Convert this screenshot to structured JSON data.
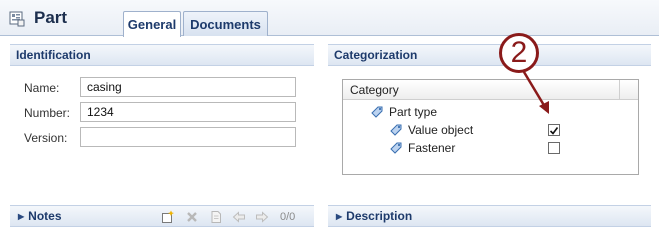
{
  "header": {
    "title": "Part",
    "icon": "part-icon",
    "tabs": [
      {
        "label": "General",
        "active": true
      },
      {
        "label": "Documents",
        "active": false
      }
    ]
  },
  "identification": {
    "title": "Identification",
    "fields": [
      {
        "label": "Name:",
        "value": "casing",
        "placeholder": ""
      },
      {
        "label": "Number:",
        "value": "1234",
        "placeholder": ""
      },
      {
        "label": "Version:",
        "value": "",
        "placeholder": ""
      }
    ]
  },
  "categorization": {
    "title": "Categorization",
    "column_header": "Category",
    "tree": [
      {
        "label": "Part type",
        "icon": "tag-icon",
        "level": 0
      },
      {
        "label": "Value object",
        "icon": "tag-icon",
        "level": 1,
        "checked": true
      },
      {
        "label": "Fastener",
        "icon": "tag-icon",
        "level": 1,
        "checked": false
      }
    ]
  },
  "notes": {
    "title": "Notes",
    "toolbar_icons": [
      "add-note-icon",
      "delete-icon",
      "note-icon",
      "arrow-left-icon",
      "arrow-right-icon"
    ],
    "count": "0/0"
  },
  "description": {
    "title": "Description"
  },
  "annotation": {
    "number": "2",
    "color": "#8a1a1a"
  },
  "colors": {
    "accent": "#1d3a6b",
    "header_bg": "#e9eef5"
  }
}
